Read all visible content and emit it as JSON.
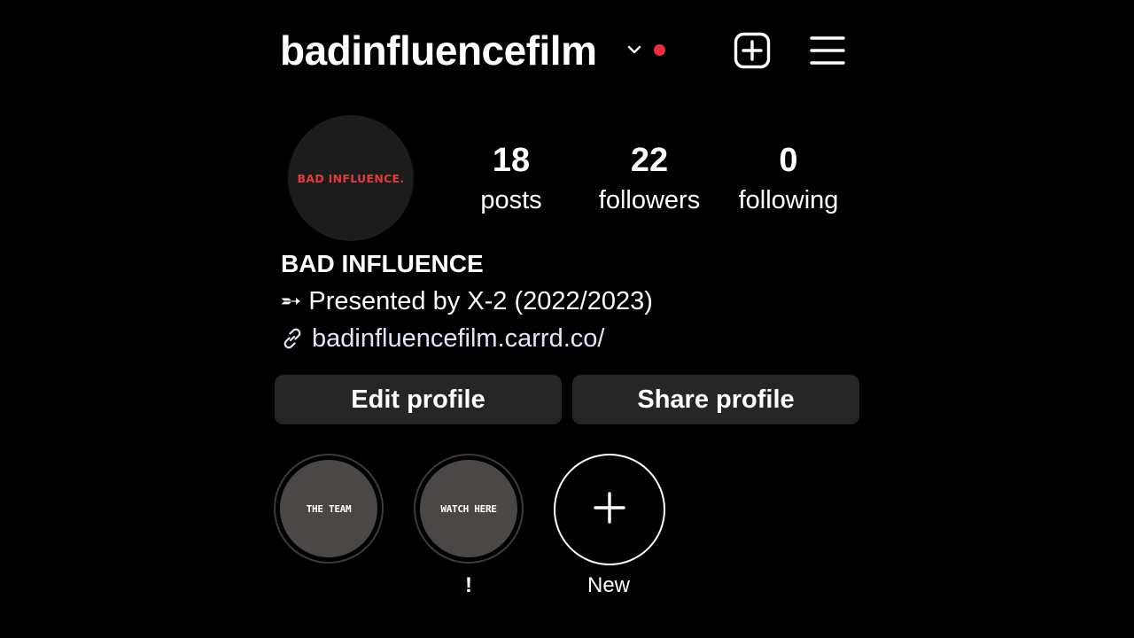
{
  "header": {
    "username": "badinfluencefilm",
    "chevron_icon": "chevron-down-icon",
    "notification_dot_color": "#e8303e",
    "add_icon": "plus-square-icon",
    "menu_icon": "hamburger-menu-icon"
  },
  "profile": {
    "avatar_text": "BAD INFLUENCE.",
    "avatar_text_color": "#e33b3b",
    "stats": [
      {
        "value": "18",
        "label": "posts"
      },
      {
        "value": "22",
        "label": "followers"
      },
      {
        "value": "0",
        "label": "following"
      }
    ]
  },
  "bio": {
    "name": "BAD INFLUENCE",
    "line": "➵ Presented by X-2 (2022/2023)",
    "link_icon": "link-icon",
    "link": "badinfluencefilm.carrd.co/"
  },
  "buttons": {
    "edit": "Edit profile",
    "share": "Share profile"
  },
  "highlights": [
    {
      "cover_text": "THE TEAM",
      "label": ""
    },
    {
      "cover_text": "WATCH HERE",
      "label": "!"
    }
  ],
  "new_highlight": {
    "icon": "plus-icon",
    "label": "New"
  }
}
